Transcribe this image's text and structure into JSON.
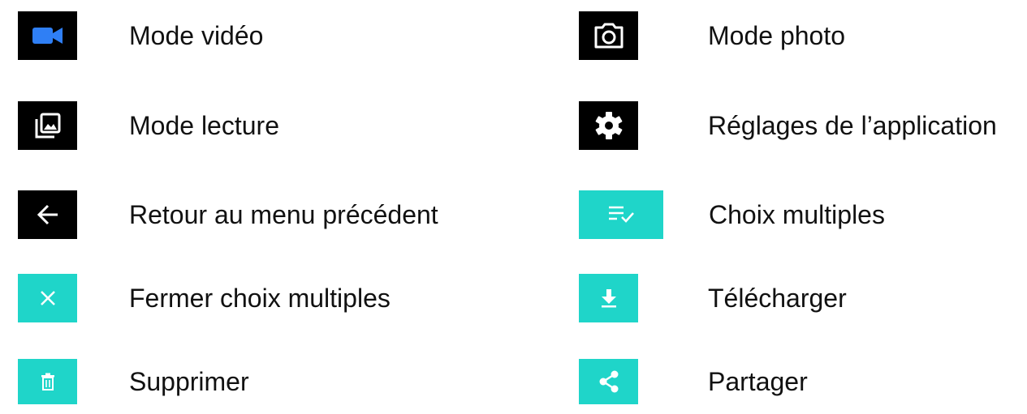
{
  "left": [
    {
      "icon": "video-camera-icon",
      "label": "Mode vidéo"
    },
    {
      "icon": "gallery-icon",
      "label": "Mode lecture"
    },
    {
      "icon": "back-arrow-icon",
      "label": "Retour au menu précédent"
    },
    {
      "icon": "close-icon",
      "label": "Fermer choix multiples"
    },
    {
      "icon": "trash-icon",
      "label": "Supprimer"
    }
  ],
  "right": [
    {
      "icon": "camera-icon",
      "label": "Mode photo"
    },
    {
      "icon": "gear-icon",
      "label": "Réglages de l’application"
    },
    {
      "icon": "checklist-icon",
      "label": "Choix multiples"
    },
    {
      "icon": "download-icon",
      "label": "Télécharger"
    },
    {
      "icon": "share-icon",
      "label": "Partager"
    }
  ],
  "colors": {
    "dark_tile": "#000000",
    "teal_tile": "#1fd5c9",
    "video_icon": "#2f7ff5"
  }
}
